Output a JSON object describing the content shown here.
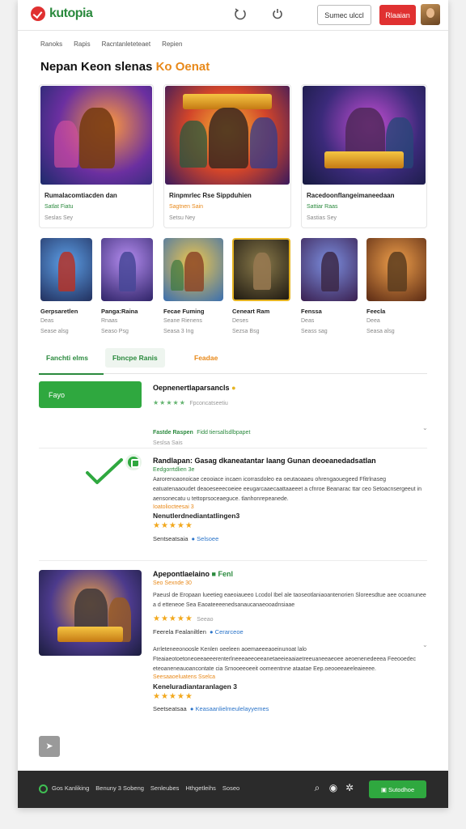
{
  "header": {
    "logo_text": "kutopia",
    "secondary_button": "Sumec ulccl",
    "primary_button": "Rlaaian"
  },
  "breadcrumb": [
    "Ranoks",
    "Rapis",
    "Racntanleteteaet",
    "Repien"
  ],
  "page_title": {
    "main": "Nepan Keon slenas",
    "accent": "Ko Oenat"
  },
  "featured": [
    {
      "title": "Rumalacomtiacden dan",
      "subtitle": "Satlat Fiatu",
      "meta": "Seslas Sey"
    },
    {
      "title": "Rinpmrlec Rse Sippduhien",
      "subtitle": "Sagtnen Sain",
      "meta": "Setsu Ney"
    },
    {
      "title": "Racedoonflangeimaneedaan",
      "subtitle": "Sattiar Raas",
      "meta": "Sastias Sey"
    }
  ],
  "games": [
    {
      "title": "Gerpsaretlen",
      "subtitle": "Deas",
      "meta": "Sease alsg"
    },
    {
      "title": "Panga:Raina",
      "subtitle": "Rnaas",
      "meta": "Seaso Psg"
    },
    {
      "title": "Fecae Fuming",
      "subtitle": "Seane Rienens",
      "meta": "Seasa 3 Ing"
    },
    {
      "title": "Ceneart Ram",
      "subtitle": "Deses",
      "meta": "Sezsa Bsg"
    },
    {
      "title": "Fenssa",
      "subtitle": "Deas",
      "meta": "Seass sag"
    },
    {
      "title": "Feecla",
      "subtitle": "Deea",
      "meta": "Seasa alsg"
    }
  ],
  "tabs": [
    "Fanchti elms",
    "Fbncpe Ranis",
    "Feadae"
  ],
  "write_button": "Fayo",
  "reviews": {
    "r1": {
      "title": "Oepnenertlaparsancls",
      "meta": "Fpconcatseetiu",
      "reply": "Fastde Raspen",
      "reply_link": "Fidd tiersallsdlbpapet",
      "date": "Seslsa Sais"
    },
    "r2": {
      "title": "Randlapan: Gasag dkaneatantar laang Gunan deoeanedadsatlan",
      "subtitle": "Eedgorrtdlien 3e",
      "body": "Aarorenoaonoicae ceooiace incaen icorrasdoleo ea oeutaoaaeu ohrengaouegeed Ffitrlnaseg eatuatenaaoudet deaoeseeecoeiee eeugarcaaecaattaaeeet a cfnroe Beanarac ttar ceo Setoacnsergeeut in aensonecatu u tettoprsoceaeguce. tlanhonrepeanede.",
      "tag": "Ioatoliocteesai 3",
      "section": "Nenutlerdnediantatlingen3",
      "footer": "Sentseatsaia",
      "footer_link": "Selsoee"
    },
    "r3": {
      "title": "Apepontlaelaino",
      "badge": "Fenl",
      "subtitle": "Seo Sexnde 30",
      "body": "Paeusl de Eropaan lueetieg eaeoiaueeo Lcodol Ibel ale taoseotlaniaoantenorien Sloreesdtue aee ocoanunee a d etteneoe Sea Eaoateeeenedsanaucanaeooadnsiaae",
      "tag": "Seeao",
      "section": "Feerela Fealaniltlen",
      "section_link": "Cerarceoe",
      "body2": "Arrleteneeonoosle Kenlen oeeleen aoemaeeeaoeinunoat lalo Fteaiaeotoetoneoeeaeeerenterlneeeaeeoeeanetaeeieaaiaetreeuaneeaeoee aeoenenedeeea Feeooedec eteoaneneauoancontate cia Srnooeeoeeit oomeentnne ataatae Eep.oeooeeaeeleaieeee.",
      "tag2": "Seesaaoeluatens Sselca",
      "section2": "Keneluradiantaranlagen 3",
      "footer": "Seetseatsaa",
      "footer_link": "Keasaanlielmeulelayyemes"
    }
  },
  "bottom_bar": {
    "links": [
      "Gos Kanliking",
      "Benuny 3 Sobeng",
      "Senleubes",
      "Hthgetleihs",
      "Soseo"
    ],
    "button": "Sutodhoe"
  },
  "colors": {
    "brand_green": "#2fa83f",
    "accent_orange": "#e8891a",
    "brand_red": "#e03131"
  }
}
